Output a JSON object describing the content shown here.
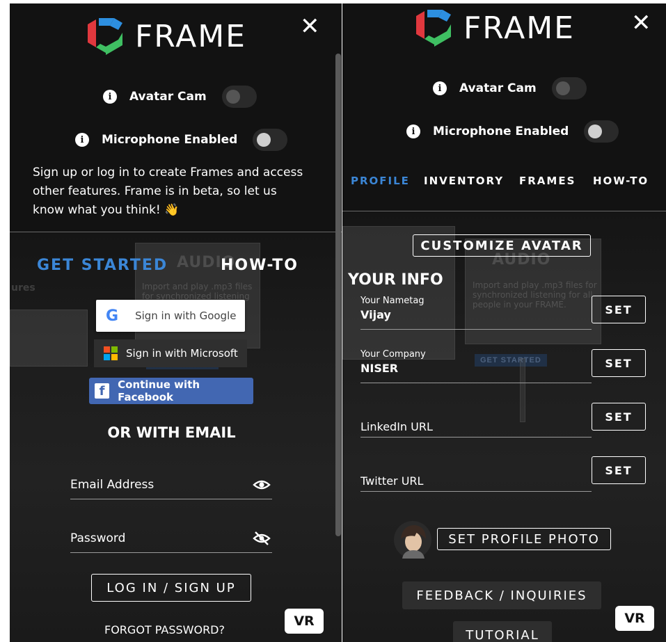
{
  "brand": {
    "name": "FRAME",
    "colors": {
      "red": "#e0383e",
      "blue": "#2d8fe0",
      "green": "#3fbf62",
      "accent": "#3b86d6"
    }
  },
  "left": {
    "close_label": "✕",
    "avatar_cam": {
      "label": "Avatar Cam",
      "enabled": false
    },
    "microphone": {
      "label": "Microphone Enabled",
      "enabled": false
    },
    "intro_text": "Sign up or log in to create Frames and access other features. Frame is in beta, so let us know what you think! 👋",
    "tabs": [
      {
        "label": "GET STARTED",
        "active": true
      },
      {
        "label": "HOW-TO",
        "active": false
      }
    ],
    "social": {
      "google": "Sign in with Google",
      "microsoft": "Sign in with Microsoft",
      "facebook": "Continue with Facebook"
    },
    "email_heading": "OR WITH EMAIL",
    "email_label": "Email Address",
    "password_label": "Password",
    "login_button": "LOG IN / SIGN UP",
    "forgot_password": "FORGOT PASSWORD?",
    "vr_button": "VR",
    "background": {
      "board_title": "AUDIO",
      "board_text": "Import and play .mp3 files for synchronized listening for all people",
      "side_label": "ures",
      "board_button": "GET STARTED"
    }
  },
  "right": {
    "close_label": "✕",
    "avatar_cam": {
      "label": "Avatar Cam",
      "enabled": false
    },
    "microphone": {
      "label": "Microphone Enabled",
      "enabled": false
    },
    "tabs": [
      {
        "label": "PROFILE",
        "active": true
      },
      {
        "label": "INVENTORY",
        "active": false
      },
      {
        "label": "FRAMES",
        "active": false
      },
      {
        "label": "HOW-TO",
        "active": false
      }
    ],
    "customize_avatar": "CUSTOMIZE AVATAR",
    "your_info_heading": "YOUR INFO",
    "fields": [
      {
        "label": "Your Nametag",
        "value": "Vijay",
        "button": "SET"
      },
      {
        "label": "Your Company",
        "value": "NISER",
        "button": "SET"
      },
      {
        "label": "LinkedIn URL",
        "value": "",
        "button": "SET"
      },
      {
        "label": "Twitter URL",
        "value": "",
        "button": "SET"
      }
    ],
    "set_profile_photo": "SET PROFILE PHOTO",
    "feedback_button": "FEEDBACK / INQUIRIES",
    "tutorial_button": "TUTORIAL",
    "vr_button": "VR",
    "background": {
      "board_title": "AUDIO",
      "board_text": "Import and play .mp3 files for synchronized listening for all people in your FRAME.",
      "board_button": "GET STARTED"
    }
  }
}
